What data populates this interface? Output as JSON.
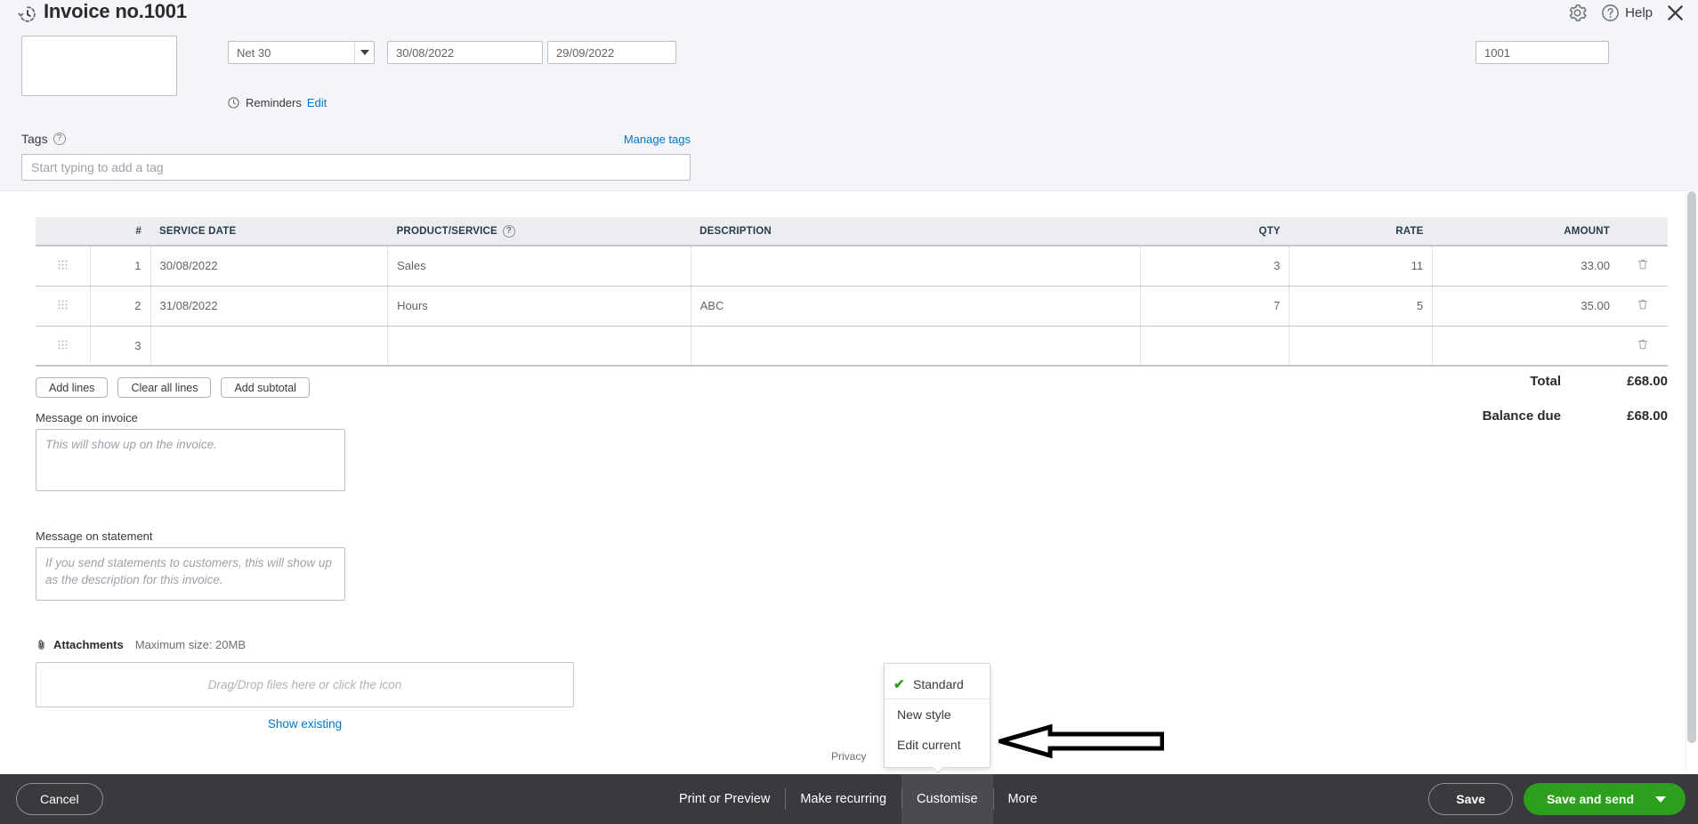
{
  "header": {
    "title": "Invoice no.1001",
    "history_icon": "history-clock-icon",
    "gear_icon": "gear-icon",
    "help_icon": "question-circle-icon",
    "help_label": "Help",
    "close_icon": "close-icon"
  },
  "form": {
    "terms_value": "Net 30",
    "invoice_date": "30/08/2022",
    "due_date": "29/09/2022",
    "invoice_no": "1001",
    "reminders_label": "Reminders",
    "reminders_edit": "Edit",
    "tags_label": "Tags",
    "manage_tags": "Manage tags",
    "tags_placeholder": "Start typing to add a tag"
  },
  "table": {
    "columns": [
      "",
      "#",
      "SERVICE DATE",
      "PRODUCT/SERVICE",
      "DESCRIPTION",
      "QTY",
      "RATE",
      "AMOUNT",
      ""
    ],
    "rows": [
      {
        "num": "1",
        "service_date": "30/08/2022",
        "product": "Sales",
        "description": "",
        "qty": "3",
        "rate": "11",
        "amount": "33.00"
      },
      {
        "num": "2",
        "service_date": "31/08/2022",
        "product": "Hours",
        "description": "ABC",
        "qty": "7",
        "rate": "5",
        "amount": "35.00"
      },
      {
        "num": "3",
        "service_date": "",
        "product": "",
        "description": "",
        "qty": "",
        "rate": "",
        "amount": ""
      }
    ]
  },
  "line_buttons": {
    "add_lines": "Add lines",
    "clear_all_lines": "Clear all lines",
    "add_subtotal": "Add subtotal"
  },
  "totals": {
    "total_label": "Total",
    "total_value": "£68.00",
    "balance_label": "Balance due",
    "balance_value": "£68.00"
  },
  "messages": {
    "invoice_label": "Message on invoice",
    "invoice_placeholder": "This will show up on the invoice.",
    "statement_label": "Message on statement",
    "statement_placeholder": "If you send statements to customers, this will show up as the description for this invoice."
  },
  "attachments": {
    "title": "Attachments",
    "max_size": "Maximum size: 20MB",
    "dropzone_text": "Drag/Drop files here or click the icon",
    "show_existing": "Show existing"
  },
  "privacy": "Privacy",
  "customise_popup": {
    "items": [
      {
        "label": "Standard",
        "checked": true
      },
      {
        "label": "New style",
        "checked": false
      },
      {
        "label": "Edit current",
        "checked": false
      }
    ],
    "check_glyph": "✔"
  },
  "bottom_bar": {
    "cancel": "Cancel",
    "links": [
      {
        "label": "Print or Preview",
        "active": false
      },
      {
        "label": "Make recurring",
        "active": false
      },
      {
        "label": "Customise",
        "active": true
      },
      {
        "label": "More",
        "active": false
      }
    ],
    "save": "Save",
    "save_and_send": "Save and send"
  },
  "colors": {
    "accent_green": "#2ca01c",
    "link_blue": "#0077c5",
    "bar_dark": "#393a3d",
    "band_bg": "#f4f5f8"
  }
}
